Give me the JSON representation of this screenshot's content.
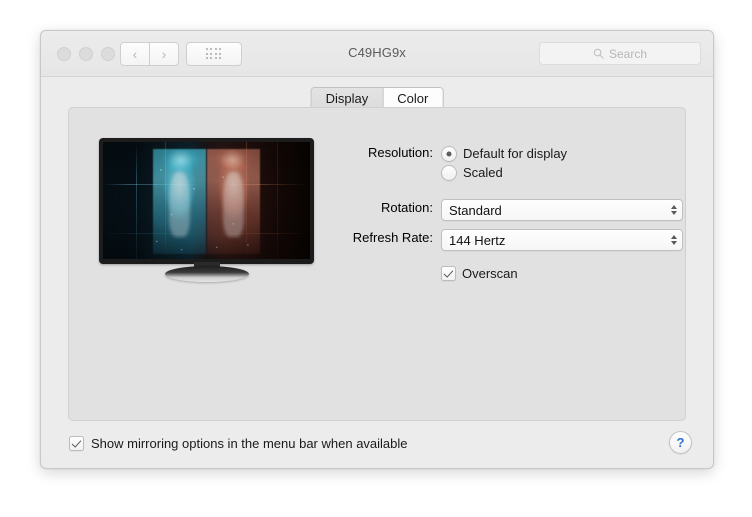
{
  "window": {
    "title": "C49HG9x",
    "traffic_lights": [
      "close",
      "minimize",
      "zoom"
    ],
    "nav": {
      "back_label": "‹",
      "forward_label": "›",
      "show_all_label": "grid-icon"
    },
    "search": {
      "placeholder": "Search",
      "value": "",
      "icon": "search-icon"
    }
  },
  "tabs": [
    {
      "label": "Display",
      "selected": true
    },
    {
      "label": "Color",
      "selected": false
    }
  ],
  "preview": {
    "device": "monitor-preview",
    "wallpaper_description": "dark wallpaper with mirrored cyan and red anime figures"
  },
  "form": {
    "resolution": {
      "label": "Resolution:",
      "options": [
        {
          "label": "Default for display",
          "selected": true
        },
        {
          "label": "Scaled",
          "selected": false
        }
      ]
    },
    "rotation": {
      "label": "Rotation:",
      "value": "Standard"
    },
    "refresh_rate": {
      "label": "Refresh Rate:",
      "value": "144 Hertz"
    },
    "overscan": {
      "label": "Overscan",
      "checked": true
    }
  },
  "footer": {
    "mirroring": {
      "label": "Show mirroring options in the menu bar when available",
      "checked": true
    },
    "help_label": "?"
  },
  "colors": {
    "window_bg": "#ececec",
    "content_bg": "#e1e1e1",
    "help_blue": "#2f6fd0",
    "text": "#1a1a1a"
  }
}
